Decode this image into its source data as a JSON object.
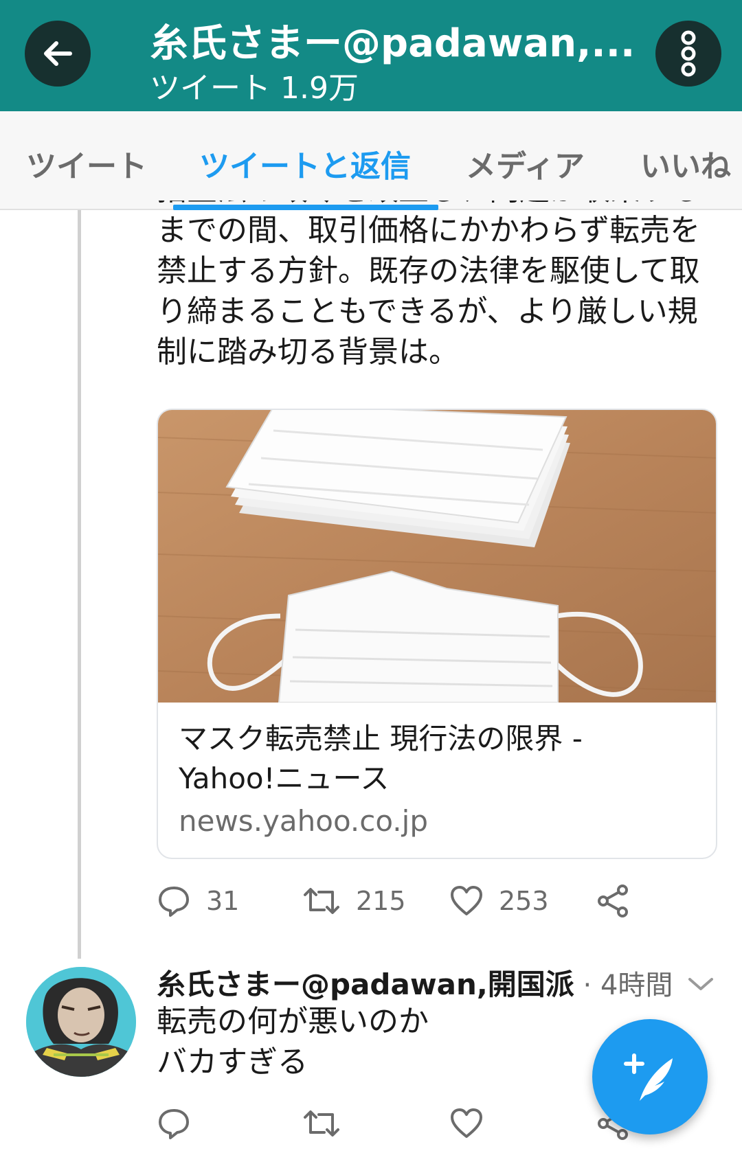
{
  "header": {
    "title": "糸氏さまー@padawan,...",
    "subtitle": "ツイート 1.9万"
  },
  "tabs": [
    {
      "label": "ツイート",
      "active": false
    },
    {
      "label": "ツイートと返信",
      "active": true
    },
    {
      "label": "メディア",
      "active": false
    },
    {
      "label": "いいね",
      "active": false
    }
  ],
  "tweet": {
    "text_lines": [
      "指置法の政令を改正し、問題が収束する",
      "までの間、取引価格にかかわらず転売を",
      "禁止する方針。既存の法律を駆使して取",
      "り締まることもできるが、より厳しい規",
      "制に踏み切る背景は。"
    ],
    "card": {
      "image_icon": "face-mask-photo",
      "title_line1": "マスク転売禁止 現行法の限界 -",
      "title_line2": "Yahoo!ニュース",
      "domain": "news.yahoo.co.jp"
    },
    "actions": {
      "replies": "31",
      "retweets": "215",
      "likes": "253"
    }
  },
  "reply": {
    "name": "糸氏さまー@padawan,開国派",
    "meta": " · 4時間",
    "text_line1": "転売の何が悪いのか",
    "text_line2": "バカすぎる"
  },
  "colors": {
    "header_bg": "#138a86",
    "accent": "#1d9bf0",
    "icon_gray": "#6b6b6b"
  }
}
